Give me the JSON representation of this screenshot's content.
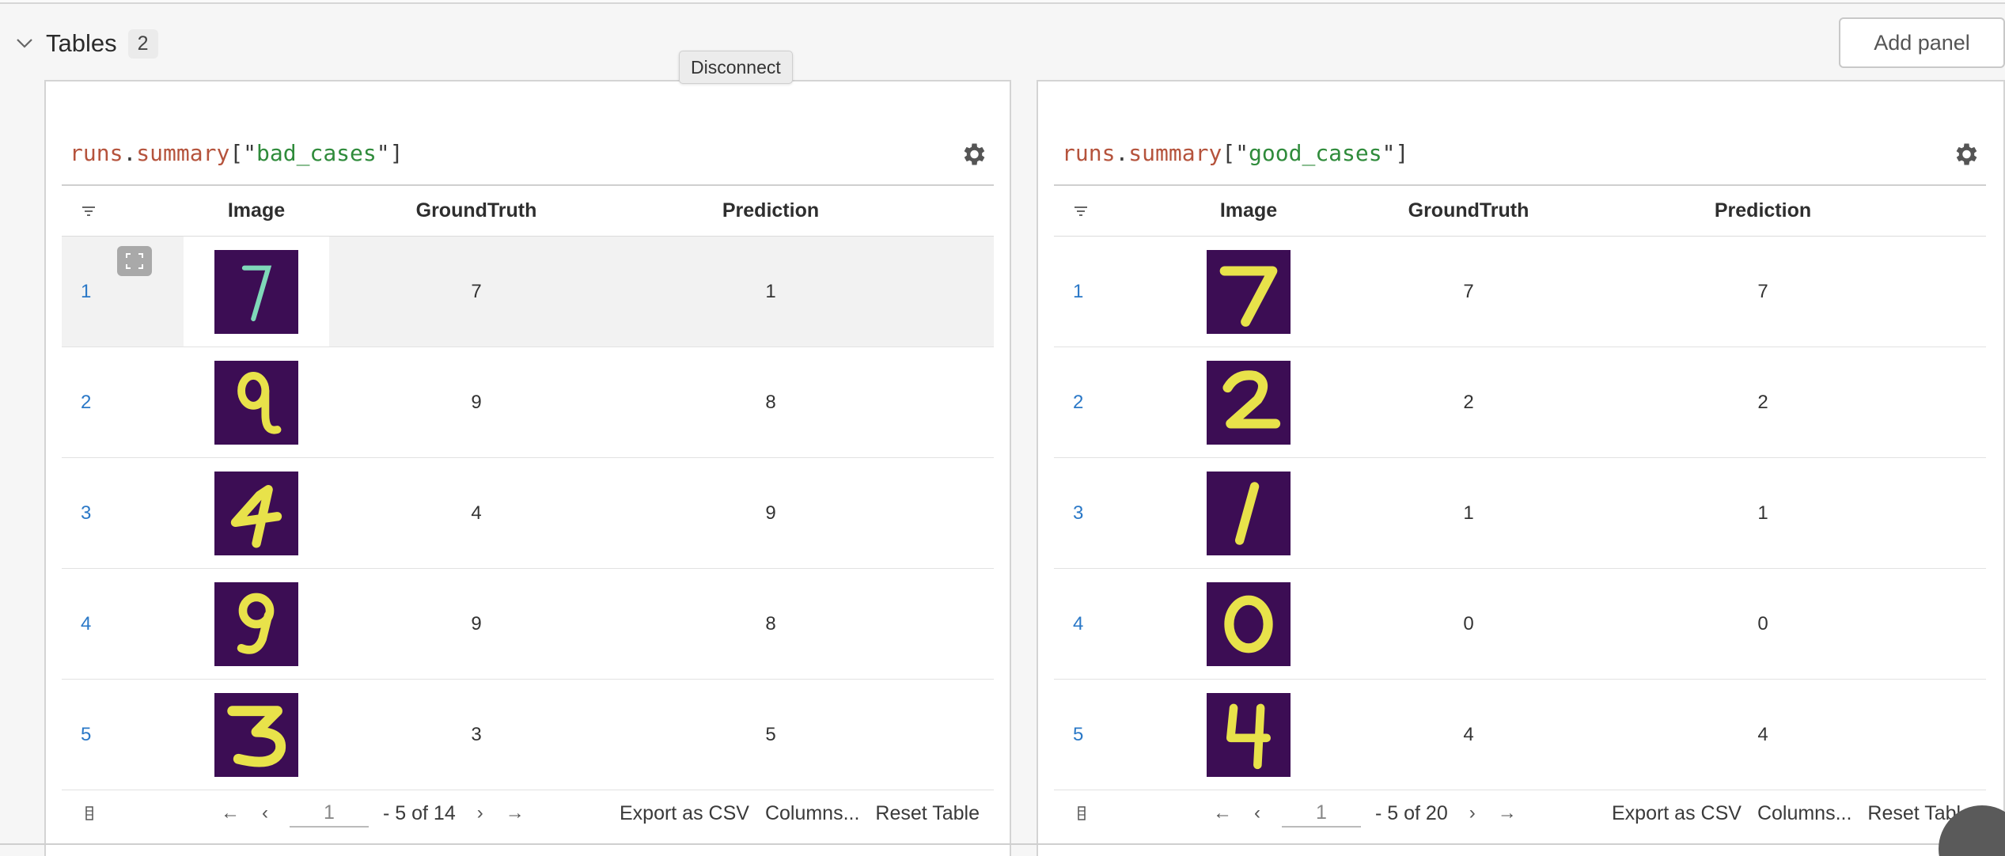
{
  "section": {
    "title": "Tables",
    "count": "2"
  },
  "add_panel_label": "Add panel",
  "tooltip": "Disconnect",
  "panels": [
    {
      "expr": {
        "obj": "runs",
        "attr": "summary",
        "key": "bad_cases"
      },
      "columns": {
        "image": "Image",
        "ground_truth": "GroundTruth",
        "prediction": "Prediction"
      },
      "rows": [
        {
          "num": "1",
          "image_digit": "7",
          "gt": "7",
          "pred": "1"
        },
        {
          "num": "2",
          "image_digit": "9",
          "gt": "9",
          "pred": "8"
        },
        {
          "num": "3",
          "image_digit": "4",
          "gt": "4",
          "pred": "9"
        },
        {
          "num": "4",
          "image_digit": "9",
          "gt": "9",
          "pred": "8"
        },
        {
          "num": "5",
          "image_digit": "3",
          "gt": "3",
          "pred": "5"
        }
      ],
      "pager": {
        "page": "1",
        "range": "- 5 of 14"
      },
      "actions": {
        "export": "Export as CSV",
        "columns": "Columns...",
        "reset": "Reset Table"
      }
    },
    {
      "expr": {
        "obj": "runs",
        "attr": "summary",
        "key": "good_cases"
      },
      "columns": {
        "image": "Image",
        "ground_truth": "GroundTruth",
        "prediction": "Prediction"
      },
      "rows": [
        {
          "num": "1",
          "image_digit": "7",
          "gt": "7",
          "pred": "7"
        },
        {
          "num": "2",
          "image_digit": "2",
          "gt": "2",
          "pred": "2"
        },
        {
          "num": "3",
          "image_digit": "1",
          "gt": "1",
          "pred": "1"
        },
        {
          "num": "4",
          "image_digit": "0",
          "gt": "0",
          "pred": "0"
        },
        {
          "num": "5",
          "image_digit": "4",
          "gt": "4",
          "pred": "4"
        }
      ],
      "pager": {
        "page": "1",
        "range": "- 5 of 20"
      },
      "actions": {
        "export": "Export as CSV",
        "columns": "Columns...",
        "reset": "Reset Table"
      }
    }
  ],
  "icons": {
    "collapse": "chevron-down-icon",
    "settings": "gear-icon",
    "filter": "filter-icon",
    "expand": "expand-icon",
    "columns": "column-settings-icon",
    "first": "first-page-icon",
    "prev": "prev-page-icon",
    "next": "next-page-icon",
    "last": "last-page-icon"
  },
  "colors": {
    "thumb_bg": "#3c0d54",
    "digit": "#e8e24a",
    "link": "#2a78c7",
    "code_keyword": "#b5533c",
    "code_string": "#2f8b3b"
  }
}
